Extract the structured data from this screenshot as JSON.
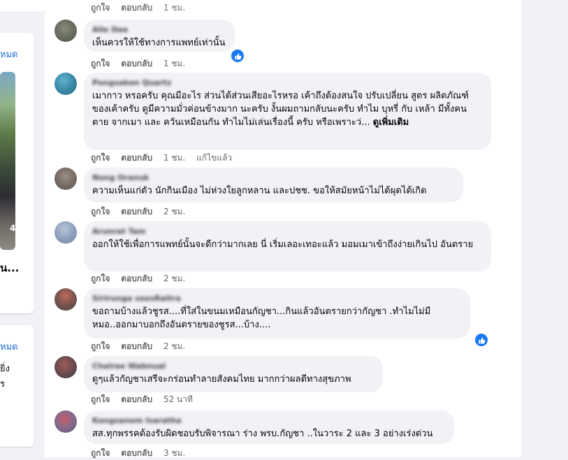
{
  "left": {
    "card1": {
      "see_all": "หมด",
      "image_number": "4",
      "title": "น..."
    },
    "card2": {
      "see_all": "หมด",
      "line1": "ยิ่ง",
      "line2": "ร"
    }
  },
  "actions": {
    "like": "ถูกใจ",
    "reply": "ตอบกลับ",
    "edited": "แก้ไขแล้ว"
  },
  "top_partial": {
    "time": "1 ชม."
  },
  "comments": [
    {
      "author": "Alle Dee",
      "text": "เห็นควรให้ใช้ทางการแพทย์เท่านั้น",
      "time": "1 ชม."
    },
    {
      "author": "Pongsakon Quartz",
      "text": "เมากาว หรอครับ คุณมีอะไร ส่วนได้ส่วนเสียอะไรหรอ เค้าถึงต้องสนใจ ปรับเปลี่ยน สูตร ผลิตภัณฑ์ของเค้าครับ ดูมีความมั่วค่อนข้างมาก นะครับ งั้นผมถามกลับนะครับ ทำไม บุหรี่ กับ เหล้า มีทั้งคนตาย จากเมา และ ควันเหมือนกัน ทำไมไม่เล่นเรื่องนี้ ครับ หรือเพราะว่...",
      "see_more": "ดูเพิ่มเติม",
      "time": "1 ชม."
    },
    {
      "author": "Nong Oranuk",
      "text": "ความเห็นแก่ตัว นักกินเมือง ไม่ห่วงใยลูกหลาน และปชช. ขอให้สมัยหน้าไม่ได้ผุดได้เกิด",
      "time": "2 ชม."
    },
    {
      "author": "Arunrat Tam",
      "text": "ออกให้ใช้เพื่อการแพทย์นั้นจะดีกว่ามากเลย นี่ เริ่มเลอะเทอะแล้ว มอมเมาเข้าถึงง่ายเกินไป อันตราย",
      "time": "2 ชม."
    },
    {
      "author": "Sirirunga seesRaitra",
      "text": "ขอถามบ้างแล้วชูรส....ที่ใส่ในขนมเหมือนกัญชา...กินแล้วอันตรายกว่ากัญชา .ทำไมไม่มี หมอ..ออกมาบอกถึงอันตรายของชูรส...บ้าง....",
      "time": "2 ชม."
    },
    {
      "author": "Chalree Wabnual",
      "text": "ดูๆแล้วกัญชาเสรีจะกร่อนทำลายสังคมไทย มากกว่าผลดีทางสุขภาพ",
      "time": "52 นาที"
    },
    {
      "author": "Kongsanom Isaratha",
      "text": "สส.ทุกพรรคต้องรับผิดชอบรับพิจารณา ร่าง พรบ.กัญชา ..ในวาระ 2 และ 3 อย่างเร่งด่วน",
      "time": "3 ชม."
    }
  ],
  "colors": {
    "accent": "#1877f2",
    "bubble": "#f0f2f5",
    "meta_text": "#65676b",
    "link": "#216fdb"
  }
}
